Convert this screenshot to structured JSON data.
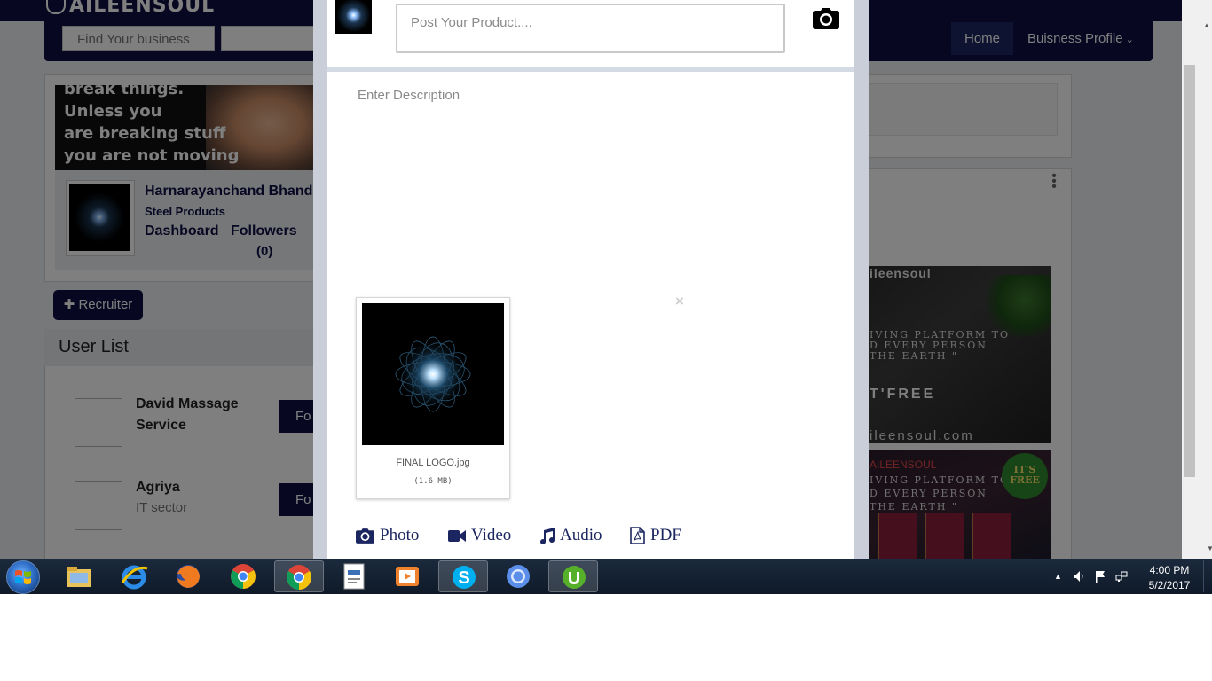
{
  "site": {
    "logo_text": "AILEENSOUL",
    "search_placeholder": "Find Your business",
    "nav_home": "Home",
    "nav_business": "Buisness Profile"
  },
  "profile": {
    "quote_text": "break things.\nUnless you\nare breaking stuff\nyou are not moving\nfast enough.\"",
    "name": "Harnarayanchand Bhand",
    "subtitle": "Steel Products",
    "dashboard_label": "Dashboard",
    "followers_label": "Followers",
    "followers_count": "(0)"
  },
  "recruiter_button": "Recruiter",
  "user_list": {
    "title": "User List",
    "users": [
      {
        "name": "David Massage\nService",
        "subtitle": "",
        "follow_label": "Fo"
      },
      {
        "name": "Agriya",
        "subtitle": "IT sector",
        "follow_label": "Fo"
      }
    ]
  },
  "ads": {
    "ad1_title": "ileensoul",
    "ad1_tagline": "IVING PLATFORM TO\nD EVERY PERSON\nTHE EARTH \"",
    "ad1_free": "T'FREE",
    "ad1_url": "ileensoul.com",
    "ad2_title": "AILEENSOUL",
    "ad2_tagline": "IVING PLATFORM TO\nD EVERY PERSON\nTHE EARTH \"",
    "ad2_badge": "IT'S\nFREE"
  },
  "modal": {
    "post_placeholder": "Post Your Product....",
    "description_placeholder": "Enter Description",
    "file": {
      "name": "FINAL LOGO.jpg",
      "size": "(1.6 MB)"
    },
    "remove_symbol": "×",
    "attachments": [
      {
        "label": "Photo",
        "icon": "camera-icon"
      },
      {
        "label": "Video",
        "icon": "video-camera-icon"
      },
      {
        "label": "Audio",
        "icon": "music-note-icon"
      },
      {
        "label": "PDF",
        "icon": "pdf-file-icon"
      }
    ]
  },
  "taskbar": {
    "apps": [
      "windows-explorer",
      "internet-explorer",
      "firefox",
      "chrome",
      "chrome-active",
      "document",
      "media-player",
      "skype",
      "chromium",
      "utorrent"
    ],
    "time": "4:00 PM",
    "date": "5/2/2017"
  },
  "colors": {
    "brand_navy": "#0e0f44",
    "overlay": "rgba(0,0,0,0.5)",
    "attachment_text": "#1b2660"
  }
}
